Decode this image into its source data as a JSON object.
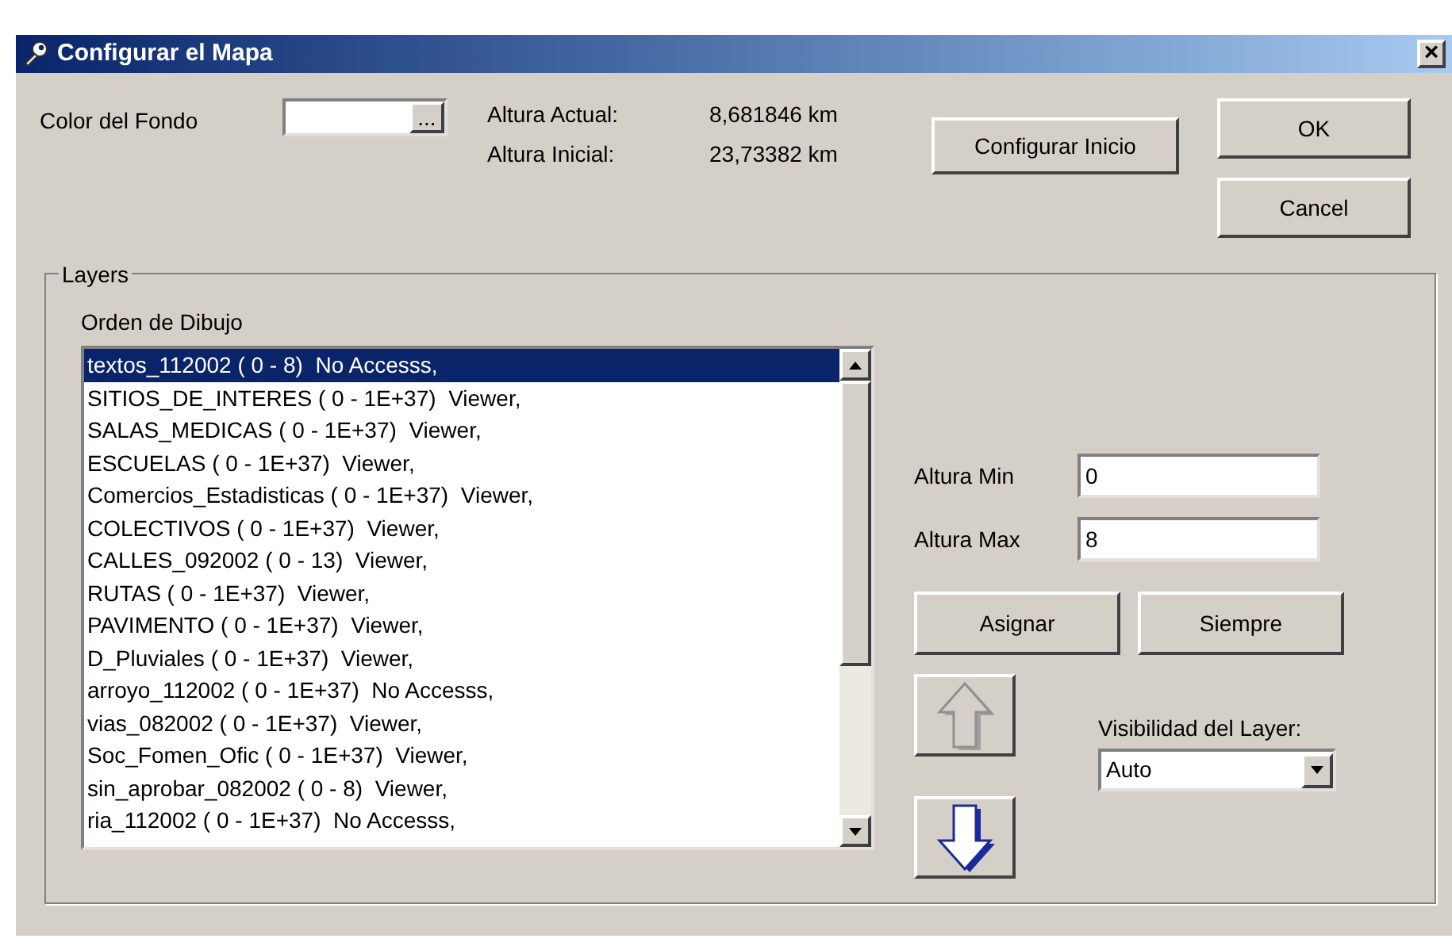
{
  "window": {
    "title": "Configurar el Mapa",
    "close": "×"
  },
  "background_color": {
    "label": "Color del Fondo",
    "button": "..."
  },
  "heights": [
    {
      "label": "Altura Actual:",
      "value": "8,681846 km"
    },
    {
      "label": "Altura Inicial:",
      "value": "23,73382 km"
    }
  ],
  "buttons": {
    "configure_start": "Configurar Inicio",
    "ok": "OK",
    "cancel": "Cancel"
  },
  "layers": {
    "title": "Layers",
    "list_label": "Orden de Dibujo",
    "items": [
      {
        "text": "textos_112002 ( 0 - 8)  No Accesss,",
        "selected": true
      },
      {
        "text": "SITIOS_DE_INTERES ( 0 - 1E+37)  Viewer,",
        "selected": false
      },
      {
        "text": "SALAS_MEDICAS ( 0 - 1E+37)  Viewer,",
        "selected": false
      },
      {
        "text": "ESCUELAS ( 0 - 1E+37)  Viewer,",
        "selected": false
      },
      {
        "text": "Comercios_Estadisticas ( 0 - 1E+37)  Viewer,",
        "selected": false
      },
      {
        "text": "COLECTIVOS ( 0 - 1E+37)  Viewer,",
        "selected": false
      },
      {
        "text": "CALLES_092002 ( 0 - 13)  Viewer,",
        "selected": false
      },
      {
        "text": "RUTAS ( 0 - 1E+37)  Viewer,",
        "selected": false
      },
      {
        "text": "PAVIMENTO ( 0 - 1E+37)  Viewer,",
        "selected": false
      },
      {
        "text": "D_Pluviales ( 0 - 1E+37)  Viewer,",
        "selected": false
      },
      {
        "text": "arroyo_112002 ( 0 - 1E+37)  No Accesss,",
        "selected": false
      },
      {
        "text": "vias_082002 ( 0 - 1E+37)  Viewer,",
        "selected": false
      },
      {
        "text": "Soc_Fomen_Ofic ( 0 - 1E+37)  Viewer,",
        "selected": false
      },
      {
        "text": "sin_aprobar_082002 ( 0 - 8)  Viewer,",
        "selected": false
      },
      {
        "text": "ria_112002 ( 0 - 1E+37)  No Accesss,",
        "selected": false
      }
    ],
    "min": {
      "label": "Altura Min",
      "value": "0"
    },
    "max": {
      "label": "Altura Max",
      "value": "8"
    },
    "assign": "Asignar",
    "always": "Siempre",
    "move_up": {
      "disabled": true
    },
    "move_down": {
      "disabled": false
    },
    "visibility": {
      "label": "Visibilidad del Layer:",
      "value": "Auto"
    }
  }
}
